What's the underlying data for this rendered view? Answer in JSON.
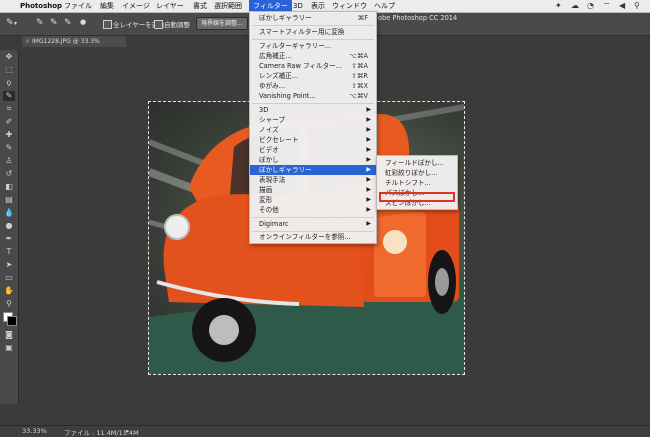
{
  "menubar": {
    "apple": "",
    "app_name": "Photoshop",
    "items": [
      "ファイル",
      "編集",
      "イメージ",
      "レイヤー",
      "書式",
      "選択範囲",
      "フィルター",
      "3D",
      "表示",
      "ウィンドウ",
      "ヘルプ"
    ],
    "active_item": "フィルター"
  },
  "window_title": "obe Photoshop CC 2014",
  "options_bar": {
    "all_layers_label": "全レイヤーを対象",
    "auto_enhance_label": "自動調整",
    "refine_edge_label": "境界線を調整..."
  },
  "document_tab": {
    "title": "IMG1228.JPG @ 33.3% (RGB/8*) *"
  },
  "statusbar": {
    "zoom": "33.33%",
    "file_info": "ファイル : 11.4M/11.4M"
  },
  "filter_menu": {
    "items": [
      {
        "label": "ぼかしギャラリー",
        "shortcut": "⌘F"
      },
      {
        "label": "スマートフィルター用に変換"
      },
      {
        "label": "フィルターギャラリー..."
      },
      {
        "label": "広角補正...",
        "shortcut": "⌥⌘A"
      },
      {
        "label": "Camera Raw フィルター...",
        "shortcut": "⇧⌘A"
      },
      {
        "label": "レンズ補正...",
        "shortcut": "⇧⌘R"
      },
      {
        "label": "ゆがみ...",
        "shortcut": "⇧⌘X"
      },
      {
        "label": "Vanishing Point...",
        "shortcut": "⌥⌘V"
      },
      {
        "label": "3D"
      },
      {
        "label": "シャープ"
      },
      {
        "label": "ノイズ"
      },
      {
        "label": "ピクセレート"
      },
      {
        "label": "ビデオ"
      },
      {
        "label": "ぼかし"
      },
      {
        "label": "ぼかしギャラリー"
      },
      {
        "label": "表現手法"
      },
      {
        "label": "描画"
      },
      {
        "label": "変形"
      },
      {
        "label": "その他"
      },
      {
        "label": "Digimarc"
      },
      {
        "label": "オンラインフィルターを参照..."
      }
    ]
  },
  "blur_gallery_submenu": {
    "items": [
      "フィールドぼかし...",
      "虹彩絞りぼかし...",
      "チルトシフト...",
      "パスぼかし...",
      "スピンぼかし..."
    ],
    "highlighted": "スピンぼかし..."
  },
  "colors": {
    "menu_highlight": "#2a63d6",
    "annotation_red": "#e23322",
    "truck_orange": "#e8501e"
  }
}
